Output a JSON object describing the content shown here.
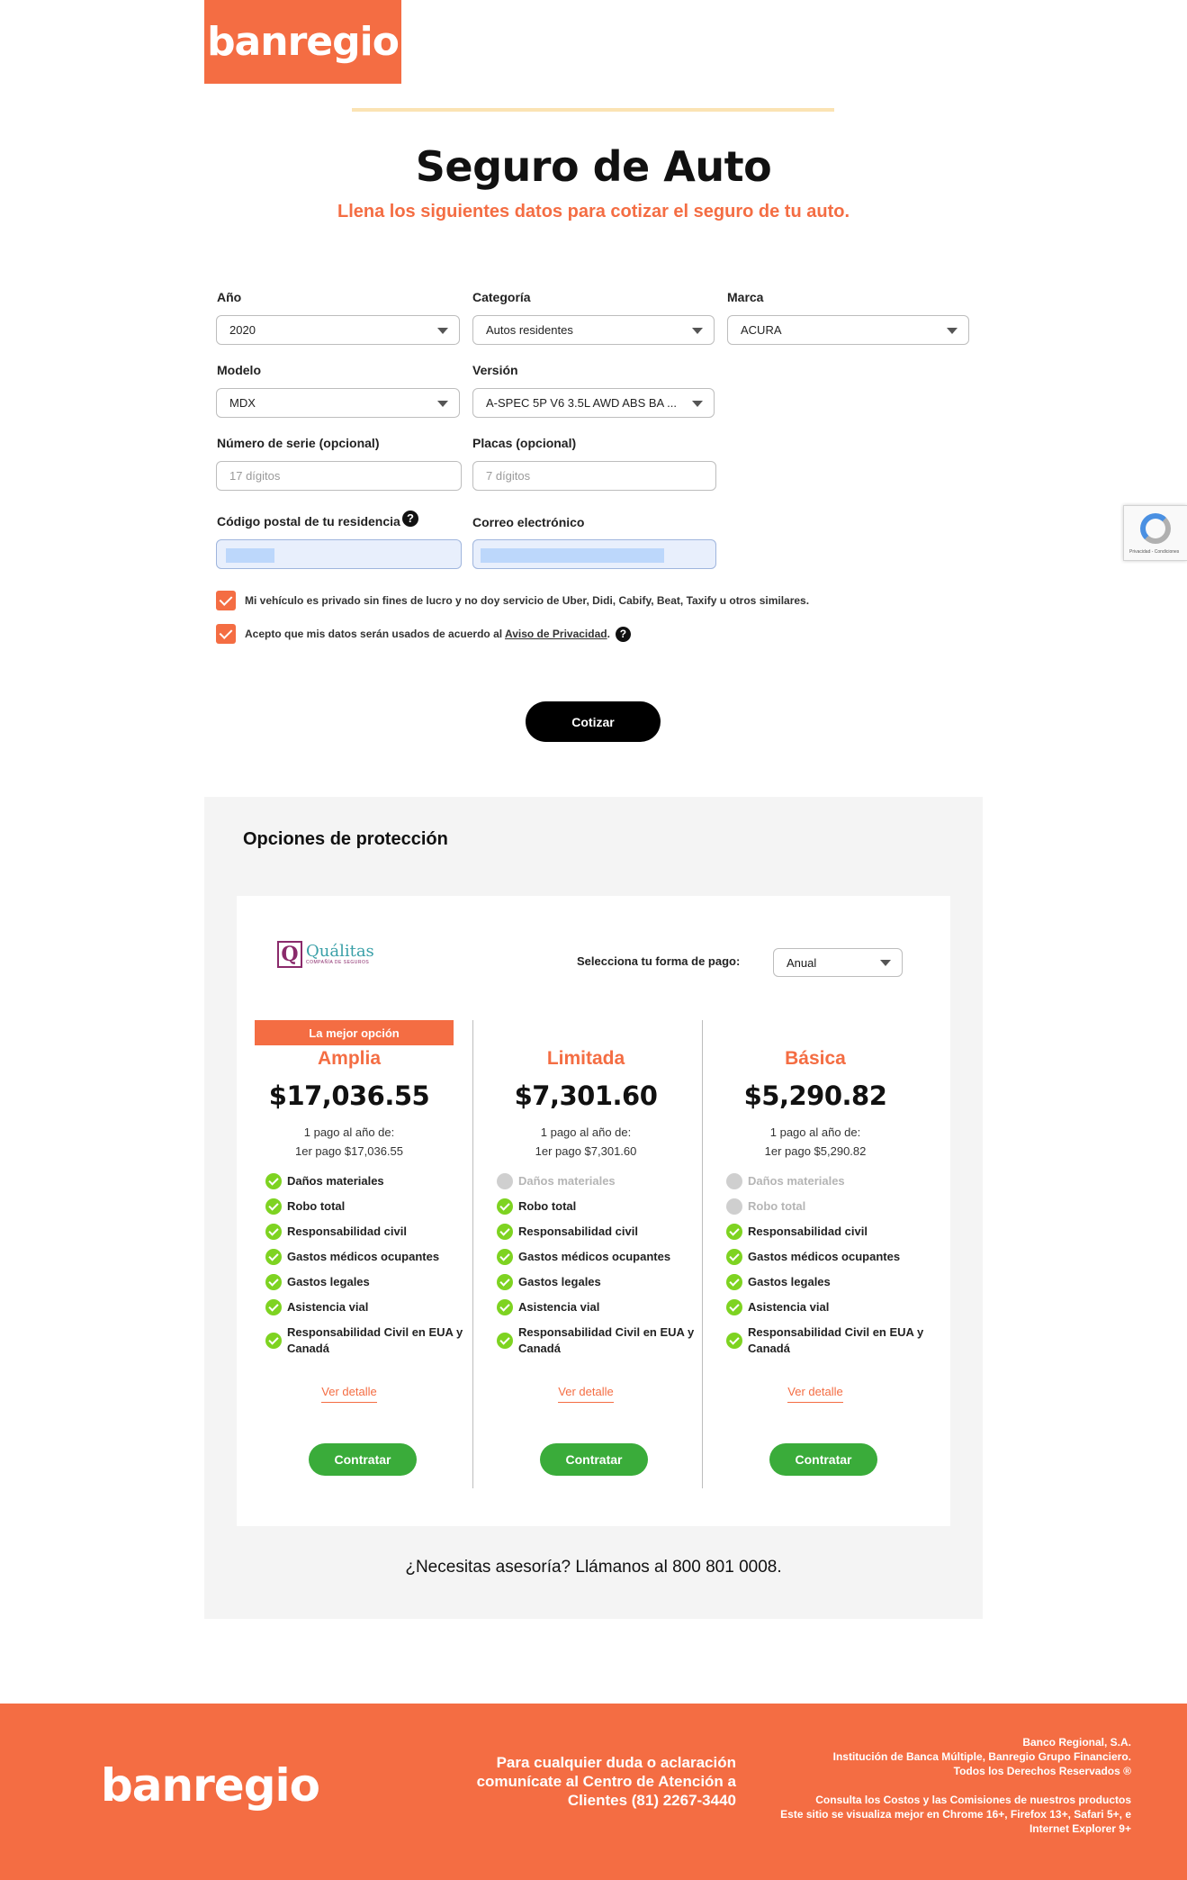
{
  "header": {
    "logo": "banregio",
    "title": "Seguro de Auto",
    "subtitle": "Llena los siguientes datos para cotizar el seguro de tu auto."
  },
  "form": {
    "year": {
      "label": "Año",
      "value": "2020"
    },
    "category": {
      "label": "Categoría",
      "value": "Autos residentes"
    },
    "brand": {
      "label": "Marca",
      "value": "ACURA"
    },
    "model": {
      "label": "Modelo",
      "value": "MDX"
    },
    "version": {
      "label": "Versión",
      "value": "A-SPEC 5P V6 3.5L AWD ABS BA ..."
    },
    "serial": {
      "label": "Número de serie (opcional)",
      "placeholder": "17 dígitos"
    },
    "plates": {
      "label": "Placas (opcional)",
      "placeholder": "7 dígitos"
    },
    "postal": {
      "label": "Código postal de tu residencia",
      "help": "?"
    },
    "email": {
      "label": "Correo electrónico"
    },
    "check_private": "Mi vehículo es privado sin fines de lucro y no doy servicio de Uber, Didi, Cabify, Beat, Taxify u otros similares.",
    "check_privacy_prefix": "Acepto que mis datos serán usados de acuerdo al ",
    "check_privacy_link": "Aviso de Privacidad",
    "check_privacy_suffix": ".",
    "check_privacy_help": "?",
    "submit": "Cotizar"
  },
  "recaptcha": {
    "text": "Privacidad - Condiciones"
  },
  "protection": {
    "title": "Opciones de protección",
    "insurer": {
      "name": "Quálitas",
      "tagline": "COMPAÑÍA DE SEGUROS",
      "mark": "Q"
    },
    "payment_label": "Selecciona tu forma de pago:",
    "payment_value": "Anual",
    "plans": [
      {
        "badge": "La mejor opción",
        "name": "Amplia",
        "price": "$17,036.55",
        "line1": "1 pago al año de:",
        "line2": "1er pago $17,036.55",
        "features": [
          {
            "label": "Daños materiales",
            "included": true
          },
          {
            "label": "Robo total",
            "included": true
          },
          {
            "label": "Responsabilidad civil",
            "included": true
          },
          {
            "label": "Gastos médicos ocupantes",
            "included": true
          },
          {
            "label": "Gastos legales",
            "included": true
          },
          {
            "label": "Asistencia vial",
            "included": true
          },
          {
            "label": "Responsabilidad Civil en EUA y Canadá",
            "included": true
          }
        ],
        "detail": "Ver detalle",
        "cta": "Contratar"
      },
      {
        "name": "Limitada",
        "price": "$7,301.60",
        "line1": "1 pago al año de:",
        "line2": "1er pago $7,301.60",
        "features": [
          {
            "label": "Daños materiales",
            "included": false
          },
          {
            "label": "Robo total",
            "included": true
          },
          {
            "label": "Responsabilidad civil",
            "included": true
          },
          {
            "label": "Gastos médicos ocupantes",
            "included": true
          },
          {
            "label": "Gastos legales",
            "included": true
          },
          {
            "label": "Asistencia vial",
            "included": true
          },
          {
            "label": "Responsabilidad Civil en EUA y Canadá",
            "included": true
          }
        ],
        "detail": "Ver detalle",
        "cta": "Contratar"
      },
      {
        "name": "Básica",
        "price": "$5,290.82",
        "line1": "1 pago al año de:",
        "line2": "1er pago $5,290.82",
        "features": [
          {
            "label": "Daños materiales",
            "included": false
          },
          {
            "label": "Robo total",
            "included": false
          },
          {
            "label": "Responsabilidad civil",
            "included": true
          },
          {
            "label": "Gastos médicos ocupantes",
            "included": true
          },
          {
            "label": "Gastos legales",
            "included": true
          },
          {
            "label": "Asistencia vial",
            "included": true
          },
          {
            "label": "Responsabilidad Civil en EUA y Canadá",
            "included": true
          }
        ],
        "detail": "Ver detalle",
        "cta": "Contratar"
      }
    ],
    "help_line": "¿Necesitas asesoría? Llámanos al 800 801 0008."
  },
  "footer": {
    "logo": "banregio",
    "contact": [
      "Para cualquier duda o aclaración",
      "comunícate al Centro de Atención a",
      "Clientes (81) 2267-3440"
    ],
    "legal_1": [
      "Banco Regional, S.A.",
      "Institución de Banca Múltiple, Banregio Grupo Financiero.",
      "Todos los Derechos Reservados ®"
    ],
    "legal_2": [
      "Consulta los Costos y las Comisiones de nuestros productos",
      "Este sitio se visualiza mejor en Chrome 16+, Firefox 13+, Safari 5+, e",
      "Internet Explorer 9+"
    ]
  },
  "colors": {
    "brand": "#f46d43",
    "success": "#3aac3a",
    "check": "#7ed321"
  }
}
